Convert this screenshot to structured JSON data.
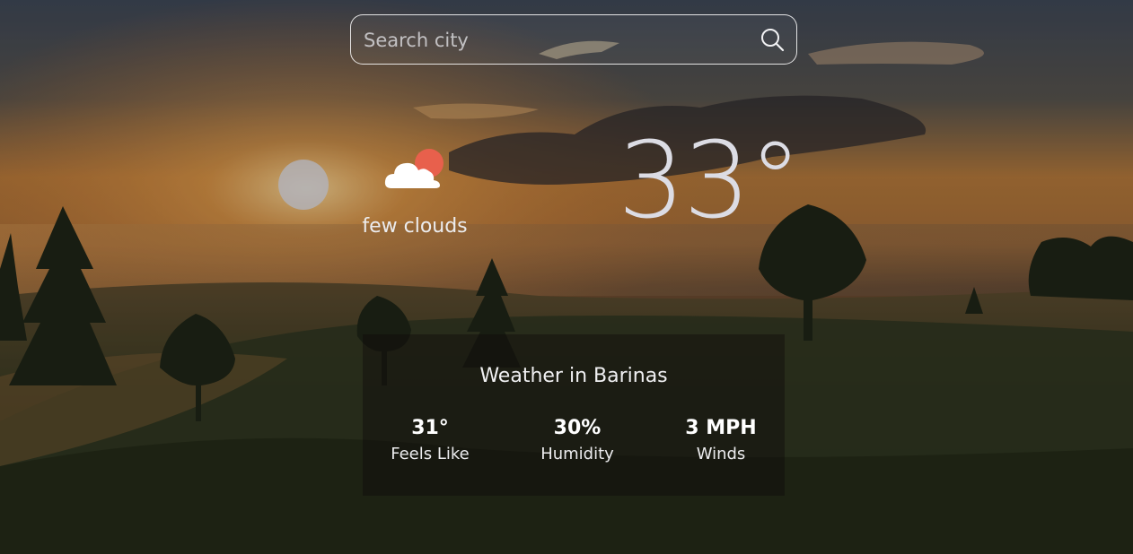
{
  "search": {
    "placeholder": "Search city",
    "icon": "search-icon"
  },
  "current": {
    "icon": "few-clouds-icon",
    "condition": "few clouds",
    "temperature": "33°"
  },
  "details": {
    "title": "Weather in Barinas",
    "stats": [
      {
        "value": "31°",
        "label": "Feels Like"
      },
      {
        "value": "30%",
        "label": "Humidity"
      },
      {
        "value": "3 MPH",
        "label": "Winds"
      }
    ]
  },
  "colors": {
    "sun": "#e8604c",
    "cloud": "#ffffff",
    "text": "#dcdce4"
  }
}
